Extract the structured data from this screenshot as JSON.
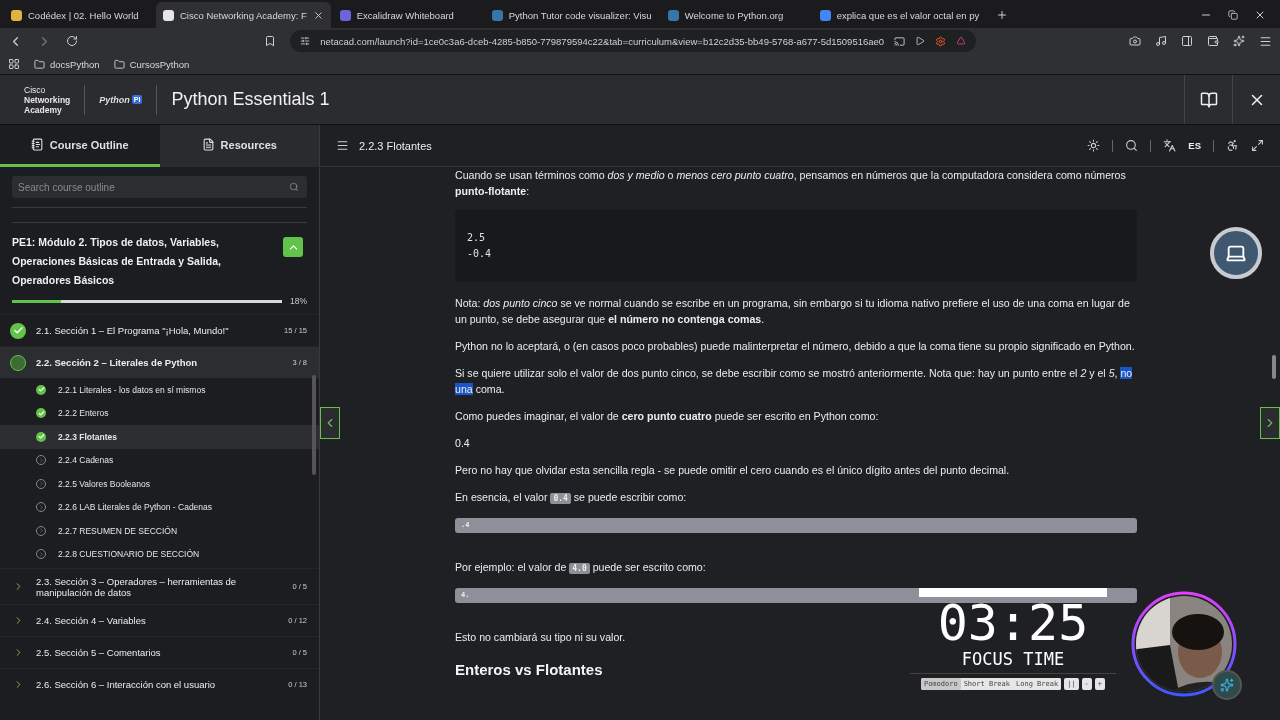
{
  "browser": {
    "tabs": [
      {
        "title": "Codédex | 02. Hello World",
        "color": "#e0b341",
        "selected": false
      },
      {
        "title": "Cisco Networking Academy: F",
        "color": "#e6e6e6",
        "selected": true
      },
      {
        "title": "Excalidraw Whiteboard",
        "color": "#6965db",
        "selected": false
      },
      {
        "title": "Python Tutor code visualizer: Visu",
        "color": "#3776ab",
        "selected": false
      },
      {
        "title": "Welcome to Python.org",
        "color": "#3776ab",
        "selected": false
      },
      {
        "title": "explica que es el valor octal en py",
        "color": "#4285f4",
        "selected": false
      }
    ],
    "url": "netacad.com/launch?id=1ce0c3a6-dceb-4285-b850-779879594c22&tab=curriculum&view=b12c2d35-bb49-5768-a677-5d1509516ae0",
    "bookmarks": [
      "docsPython",
      "CursosPython"
    ]
  },
  "header": {
    "brand": [
      "Cisco",
      "Networking",
      "Academy"
    ],
    "logo_text": "Python",
    "logo_badge": "PI",
    "title": "Python Essentials 1"
  },
  "sidebar": {
    "tabs": [
      {
        "label": "Course Outline",
        "selected": true
      },
      {
        "label": "Resources",
        "selected": false
      }
    ],
    "search": {
      "placeholder": "Search course outline"
    },
    "module": {
      "title": "PE1: Módulo 2. Tipos de datos, Variables, Operaciones Básicas de Entrada y Salida, Operadores Básicos",
      "expanded": true,
      "level": 0.18,
      "percent": "18%"
    },
    "sections": [
      {
        "title": "2.1. Sección 1 – El Programa \"¡Hola, Mundo!\"",
        "count": "15 / 15",
        "done": true,
        "expanded": false
      },
      {
        "title": "2.2. Sección 2 – Literales de Python",
        "count": "3 / 8",
        "done": false,
        "expanded": true,
        "children": [
          {
            "title": "2.2.1 Literales - los datos en sí mismos",
            "done": true,
            "selected": false
          },
          {
            "title": "2.2.2 Enteros",
            "done": true,
            "selected": false
          },
          {
            "title": "2.2.3 Flotantes",
            "done": true,
            "selected": true
          },
          {
            "title": "2.2.4 Cadenas",
            "done": false,
            "selected": false
          },
          {
            "title": "2.2.5 Valores Booleanos",
            "done": false,
            "selected": false
          },
          {
            "title": "2.2.6 LAB Literales de Python - Cadenas",
            "done": false,
            "selected": false
          },
          {
            "title": "2.2.7 RESUMEN DE SECCIÓN",
            "done": false,
            "selected": false
          },
          {
            "title": "2.2.8 CUESTIONARIO DE SECCIÓN",
            "done": false,
            "selected": false
          }
        ]
      },
      {
        "title": "2.3. Sección 3 – Operadores – herramientas de manipulación de datos",
        "count": "0 / 5",
        "done": false,
        "expanded": false
      },
      {
        "title": "2.4. Sección 4 – Variables",
        "count": "0 / 12",
        "done": false,
        "expanded": false
      },
      {
        "title": "2.5. Sección 5 – Comentarios",
        "count": "0 / 5",
        "done": false,
        "expanded": false
      },
      {
        "title": "2.6. Sección 6 – Interacción con el usuario",
        "count": "0 / 13",
        "done": false,
        "expanded": false
      }
    ]
  },
  "lesson": {
    "title": "2.2.3 Flotantes",
    "language": "ES",
    "blocks": [
      {
        "kind": "paragraph",
        "parts": [
          {
            "kind": "plain",
            "text": "Cuando se usan términos como *dos y medio* o *menos cero punto cuatro*, pensamos en números que la computadora considera como números **punto-flotante**:"
          }
        ]
      },
      {
        "kind": "code_dark",
        "lines": [
          "2.5",
          "-0.4"
        ]
      },
      {
        "kind": "paragraph",
        "parts": [
          {
            "kind": "plain",
            "text": "Nota: *dos punto cinco* se ve normal cuando se escribe en un programa, sin embargo si tu idioma nativo prefiere el uso de una coma en lugar de un punto, se debe asegurar que **el número no contenga comas**."
          }
        ]
      },
      {
        "kind": "paragraph",
        "parts": [
          {
            "kind": "plain",
            "text": "Python no lo aceptará, o (en casos poco probables) puede malinterpretar el número, debido a que la coma tiene su propio significado en Python."
          }
        ]
      },
      {
        "kind": "paragraph",
        "parts": [
          {
            "kind": "plain",
            "text": "Si se quiere utilizar solo el valor de dos punto cinco, se debe escribir como se mostró anteriormente. Nota que: hay un punto entre el *2* y el *5*, "
          },
          {
            "kind": "selected",
            "text": "no una"
          },
          {
            "kind": "plain",
            "text": " coma."
          }
        ]
      },
      {
        "kind": "paragraph",
        "parts": [
          {
            "kind": "plain",
            "text": "Como puedes imaginar, el valor de **cero punto cuatro** puede ser escrito en Python como:"
          }
        ]
      },
      {
        "kind": "paragraph",
        "parts": [
          {
            "kind": "plain",
            "text": "0.4"
          }
        ]
      },
      {
        "kind": "paragraph",
        "parts": [
          {
            "kind": "plain",
            "text": "Pero no hay que olvidar esta sencilla regla - se puede omitir el cero cuando es el único dígito antes del punto decimal."
          }
        ]
      },
      {
        "kind": "paragraph",
        "parts": [
          {
            "kind": "plain",
            "text": "En esencia, el valor "
          },
          {
            "kind": "code",
            "text": "0.4"
          },
          {
            "kind": "plain",
            "text": " se puede escribir como:"
          }
        ]
      },
      {
        "kind": "code_light",
        "lines": [
          ".4"
        ]
      },
      {
        "kind": "paragraph",
        "parts": [
          {
            "kind": "plain",
            "text": "Por ejemplo: el valor de "
          },
          {
            "kind": "code",
            "text": "4.0"
          },
          {
            "kind": "plain",
            "text": " puede ser escrito como:"
          }
        ]
      },
      {
        "kind": "code_light",
        "lines": [
          "4."
        ]
      },
      {
        "kind": "paragraph",
        "parts": [
          {
            "kind": "plain",
            "text": "Esto no cambiará su tipo ni su valor."
          }
        ]
      },
      {
        "kind": "heading",
        "text": "Enteros vs Flotantes"
      }
    ]
  },
  "timer": {
    "time": "03:25",
    "mode": "FOCUS TIME",
    "modes": [
      {
        "label": "Pomodoro",
        "selected": true
      },
      {
        "label": "Short Break",
        "selected": false
      },
      {
        "label": "Long Break",
        "selected": false
      }
    ],
    "controls": [
      "||",
      "-",
      "+"
    ]
  }
}
